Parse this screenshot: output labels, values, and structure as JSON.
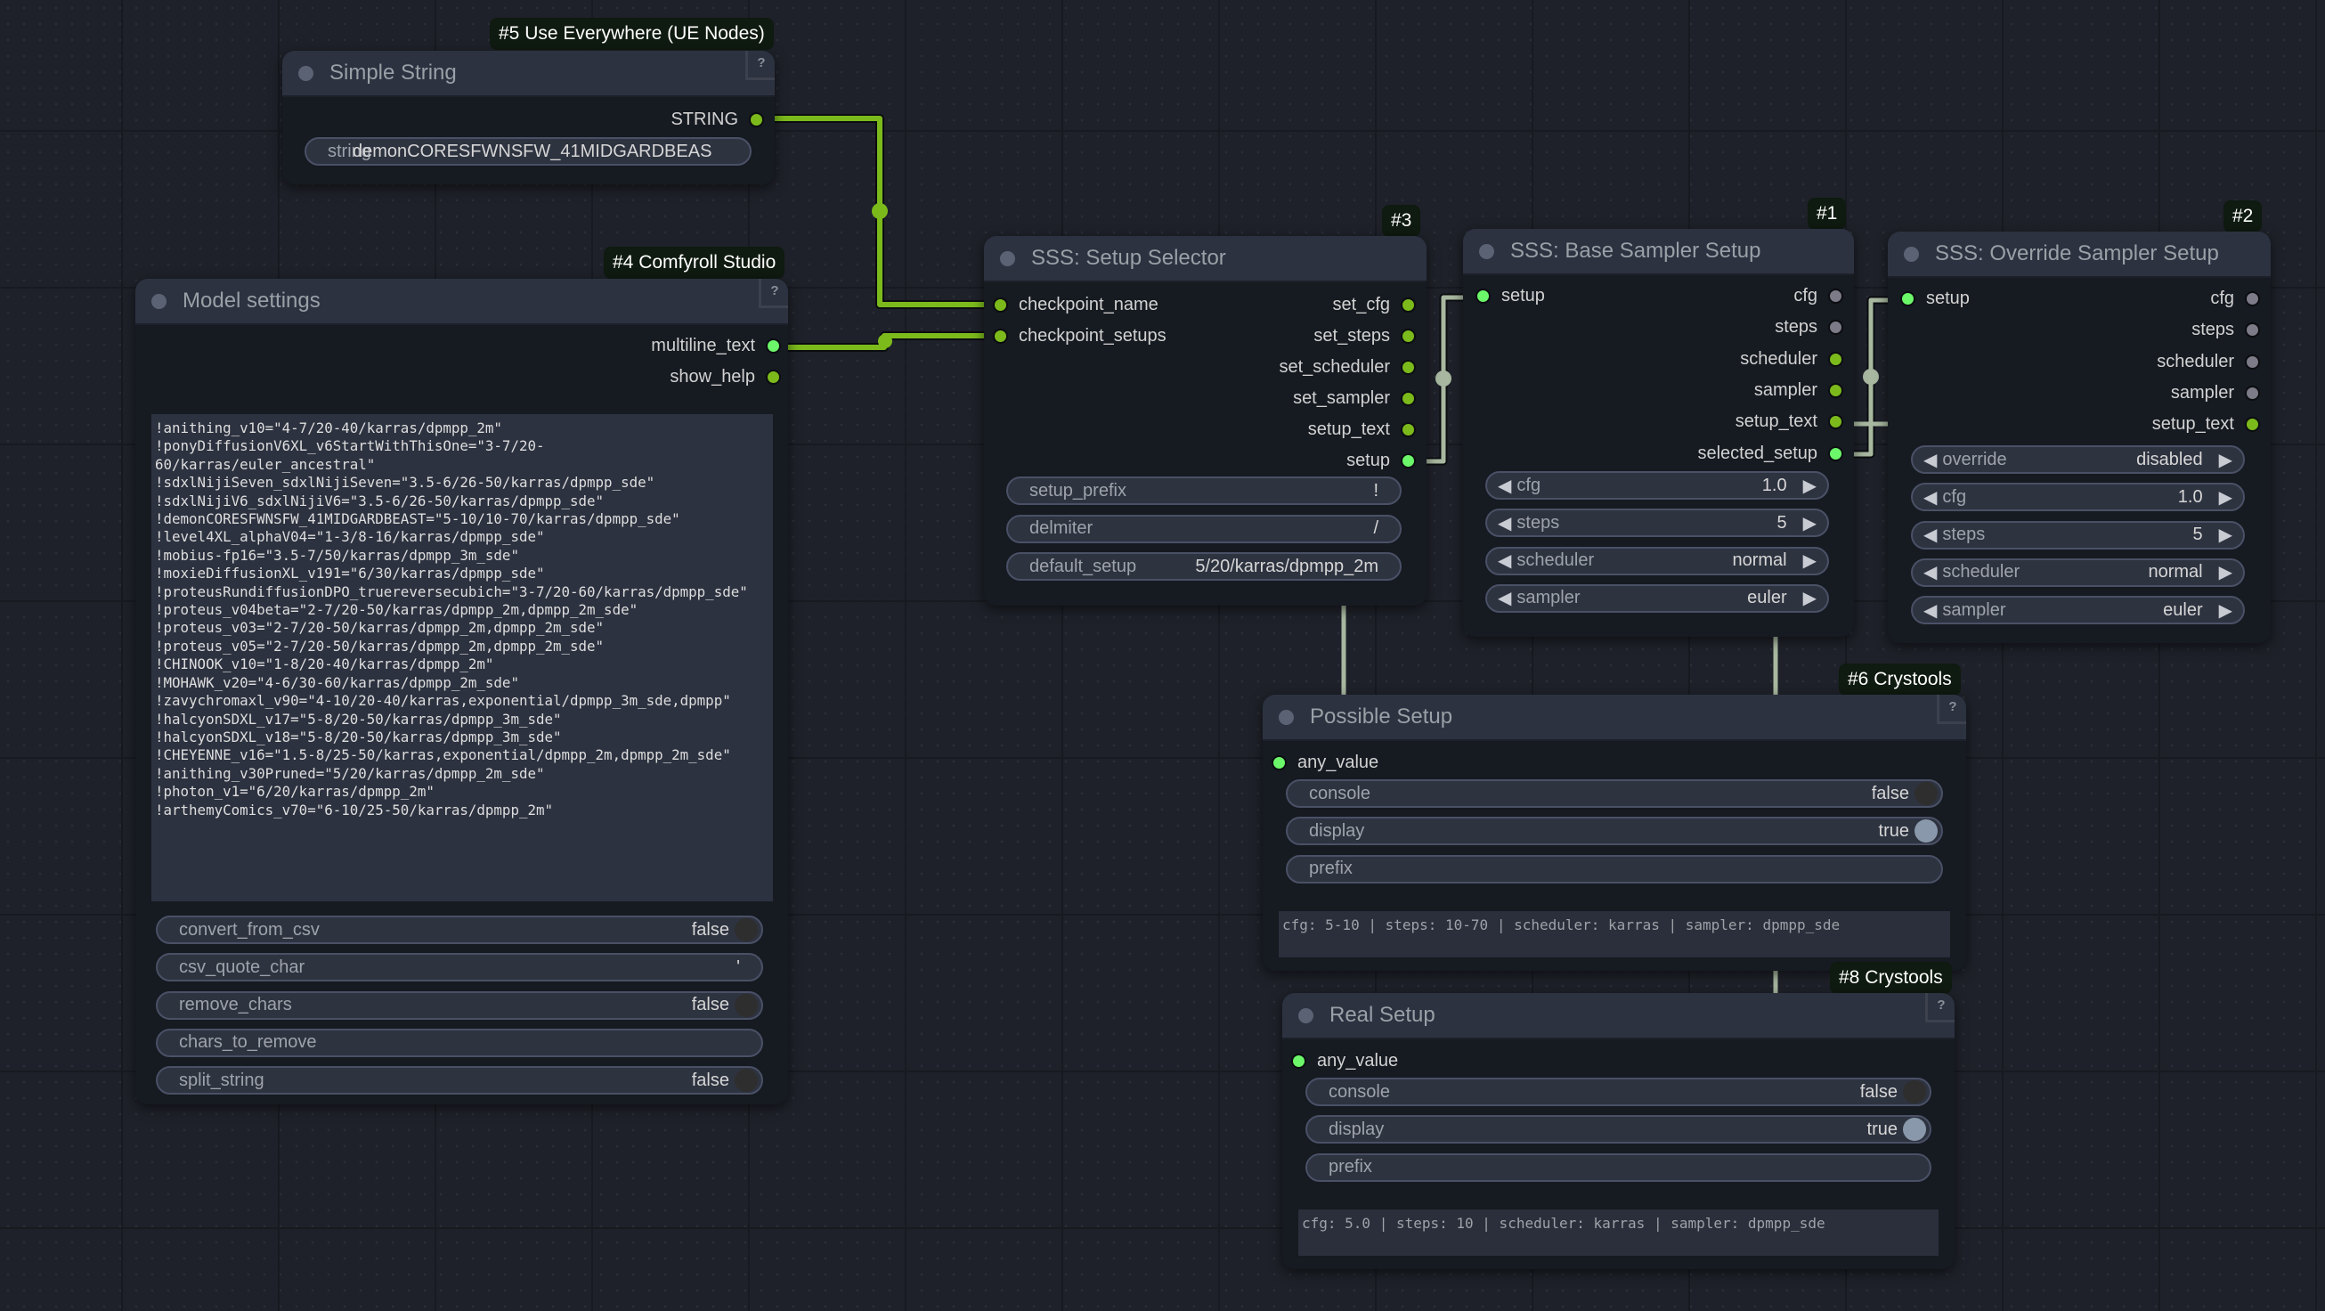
{
  "colors": {
    "link_green": "#7cba1c",
    "link_setup": "#a8b8a0",
    "pin_green": "#7cba1c",
    "pin_bright": "#6cf76a",
    "pin_grey": "#7c7b87",
    "canvas_bg": "#1e2129"
  },
  "nodes": {
    "simple_string": {
      "tag": "#5 Use Everywhere (UE Nodes)",
      "title": "Simple String",
      "help": "?",
      "outputs": [
        {
          "label": "STRING",
          "pin": "green"
        }
      ],
      "widget": {
        "label": "string",
        "value": "demonCORESFWNSFW_41MIDGARDBEAS"
      }
    },
    "model_settings": {
      "tag": "#4 Comfyroll Studio",
      "title": "Model settings",
      "help": "?",
      "outputs": [
        {
          "label": "multiline_text",
          "pin": "bright"
        },
        {
          "label": "show_help",
          "pin": "green"
        }
      ],
      "text_lines": [
        "!anithing_v10=\"4-7/20-40/karras/dpmpp_2m\"",
        "!ponyDiffusionV6XL_v6StartWithThisOne=\"3-7/20-",
        "60/karras/euler_ancestral\"",
        "!sdxlNijiSeven_sdxlNijiSeven=\"3.5-6/26-50/karras/dpmpp_sde\"",
        "!sdxlNijiV6_sdxlNijiV6=\"3.5-6/26-50/karras/dpmpp_sde\"",
        "!demonCORESFWNSFW_41MIDGARDBEAST=\"5-10/10-70/karras/dpmpp_sde\"",
        "!level4XL_alphaV04=\"1-3/8-16/karras/dpmpp_sde\"",
        "!mobius-fp16=\"3.5-7/50/karras/dpmpp_3m_sde\"",
        "!moxieDiffusionXL_v191=\"6/30/karras/dpmpp_sde\"",
        "!proteusRundiffusionDPO_truereversecubich=\"3-7/20-60/karras/dpmpp_sde\"",
        "!proteus_v04beta=\"2-7/20-50/karras/dpmpp_2m,dpmpp_2m_sde\"",
        "!proteus_v03=\"2-7/20-50/karras/dpmpp_2m,dpmpp_2m_sde\"",
        "!proteus_v05=\"2-7/20-50/karras/dpmpp_2m,dpmpp_2m_sde\"",
        "!CHINOOK_v10=\"1-8/20-40/karras/dpmpp_2m\"",
        "!MOHAWK_v20=\"4-6/30-60/karras/dpmpp_2m_sde\"",
        "!zavychromaxl_v90=\"4-10/20-40/karras,exponential/dpmpp_3m_sde,dpmpp\"",
        "!halcyonSDXL_v17=\"5-8/20-50/karras/dpmpp_3m_sde\"",
        "!halcyonSDXL_v18=\"5-8/20-50/karras/dpmpp_3m_sde\"",
        "!CHEYENNE_v16=\"1.5-8/25-50/karras,exponential/dpmpp_2m,dpmpp_2m_sde\"",
        "!anithing_v30Pruned=\"5/20/karras/dpmpp_2m_sde\"",
        "!photon_v1=\"6/20/karras/dpmpp_2m\"",
        "!arthemyComics_v70=\"6-10/25-50/karras/dpmpp_2m\""
      ],
      "widgets": [
        {
          "label": "convert_from_csv",
          "value": "false",
          "type": "toggle",
          "on": false
        },
        {
          "label": "csv_quote_char",
          "value": "'",
          "type": "text"
        },
        {
          "label": "remove_chars",
          "value": "false",
          "type": "toggle",
          "on": false
        },
        {
          "label": "chars_to_remove",
          "value": "",
          "type": "text"
        },
        {
          "label": "split_string",
          "value": "false",
          "type": "toggle",
          "on": false
        }
      ]
    },
    "setup_selector": {
      "tag": "#3",
      "title": "SSS: Setup Selector",
      "inputs": [
        {
          "label": "checkpoint_name",
          "pin": "green"
        },
        {
          "label": "checkpoint_setups",
          "pin": "green"
        }
      ],
      "outputs": [
        {
          "label": "set_cfg",
          "pin": "green"
        },
        {
          "label": "set_steps",
          "pin": "green"
        },
        {
          "label": "set_scheduler",
          "pin": "green"
        },
        {
          "label": "set_sampler",
          "pin": "green"
        },
        {
          "label": "setup_text",
          "pin": "green"
        },
        {
          "label": "setup",
          "pin": "bright"
        }
      ],
      "widgets": [
        {
          "label": "setup_prefix",
          "value": "!"
        },
        {
          "label": "delmiter",
          "value": "/"
        },
        {
          "label": "default_setup",
          "value": "5/20/karras/dpmpp_2m"
        }
      ]
    },
    "base_sampler": {
      "tag": "#1",
      "title": "SSS: Base Sampler Setup",
      "inputs": [
        {
          "label": "setup",
          "pin": "bright"
        }
      ],
      "outputs": [
        {
          "label": "cfg",
          "pin": "grey"
        },
        {
          "label": "steps",
          "pin": "grey"
        },
        {
          "label": "scheduler",
          "pin": "green"
        },
        {
          "label": "sampler",
          "pin": "green"
        },
        {
          "label": "setup_text",
          "pin": "green"
        },
        {
          "label": "selected_setup",
          "pin": "bright"
        }
      ],
      "widgets": [
        {
          "label": "cfg",
          "value": "1.0"
        },
        {
          "label": "steps",
          "value": "5"
        },
        {
          "label": "scheduler",
          "value": "normal"
        },
        {
          "label": "sampler",
          "value": "euler"
        }
      ]
    },
    "override_sampler": {
      "tag": "#2",
      "title": "SSS: Override Sampler Setup",
      "inputs": [
        {
          "label": "setup",
          "pin": "bright"
        }
      ],
      "outputs": [
        {
          "label": "cfg",
          "pin": "grey"
        },
        {
          "label": "steps",
          "pin": "grey"
        },
        {
          "label": "scheduler",
          "pin": "grey"
        },
        {
          "label": "sampler",
          "pin": "grey"
        },
        {
          "label": "setup_text",
          "pin": "green"
        }
      ],
      "widgets": [
        {
          "label": "override",
          "value": "disabled"
        },
        {
          "label": "cfg",
          "value": "1.0"
        },
        {
          "label": "steps",
          "value": "5"
        },
        {
          "label": "scheduler",
          "value": "normal"
        },
        {
          "label": "sampler",
          "value": "euler"
        }
      ]
    },
    "possible_setup": {
      "tag": "#6 Crystools",
      "title": "Possible Setup",
      "help": "?",
      "inputs": [
        {
          "label": "any_value",
          "pin": "bright"
        }
      ],
      "widgets": [
        {
          "label": "console",
          "value": "false",
          "on": false
        },
        {
          "label": "display",
          "value": "true",
          "on": true
        },
        {
          "label": "prefix",
          "value": ""
        }
      ],
      "display_text": "cfg: 5-10 | steps: 10-70 | scheduler: karras | sampler: dpmpp_sde"
    },
    "real_setup": {
      "tag": "#8 Crystools",
      "title": "Real Setup",
      "help": "?",
      "inputs": [
        {
          "label": "any_value",
          "pin": "bright"
        }
      ],
      "widgets": [
        {
          "label": "console",
          "value": "false",
          "on": false
        },
        {
          "label": "display",
          "value": "true",
          "on": true
        },
        {
          "label": "prefix",
          "value": ""
        }
      ],
      "display_text": "cfg: 5.0 | steps: 10 | scheduler: karras | sampler: dpmpp_sde"
    }
  },
  "icons": {
    "arrow_left": "◀",
    "arrow_right": "▶"
  }
}
